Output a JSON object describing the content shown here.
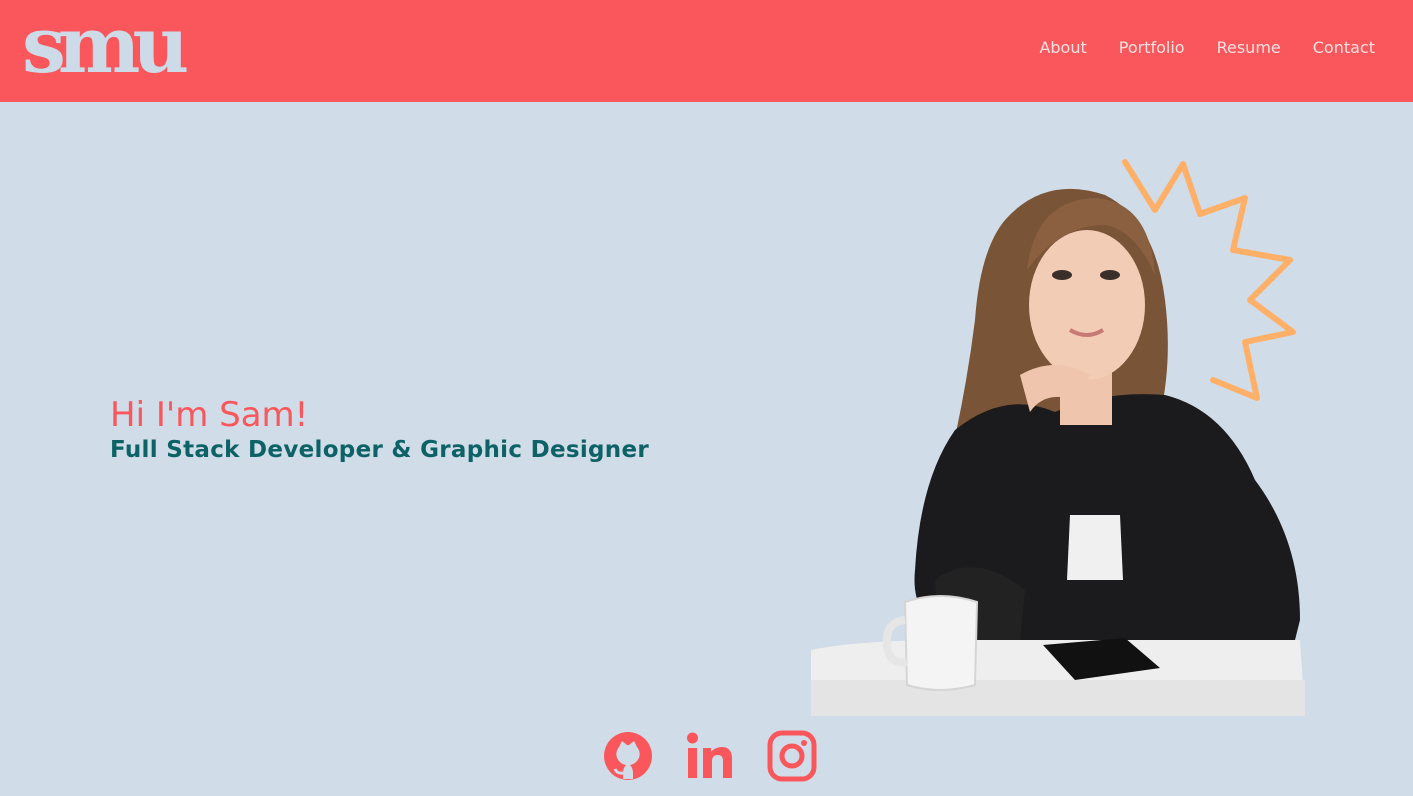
{
  "brand": {
    "logo_text": "smu",
    "accent_color": "#f9575b",
    "background_color": "#d0dce8",
    "subtitle_color": "#0d6266",
    "decor_color": "#ffb068"
  },
  "nav": {
    "items": [
      {
        "label": "About"
      },
      {
        "label": "Portfolio"
      },
      {
        "label": "Resume"
      },
      {
        "label": "Contact"
      }
    ]
  },
  "hero": {
    "title": "Hi I'm Sam!",
    "subtitle": "Full Stack Developer & Graphic Designer"
  },
  "portrait": {
    "description_icon": "portrait-photo"
  },
  "socials": [
    {
      "icon": "github-icon"
    },
    {
      "icon": "linkedin-icon"
    },
    {
      "icon": "instagram-icon"
    }
  ]
}
